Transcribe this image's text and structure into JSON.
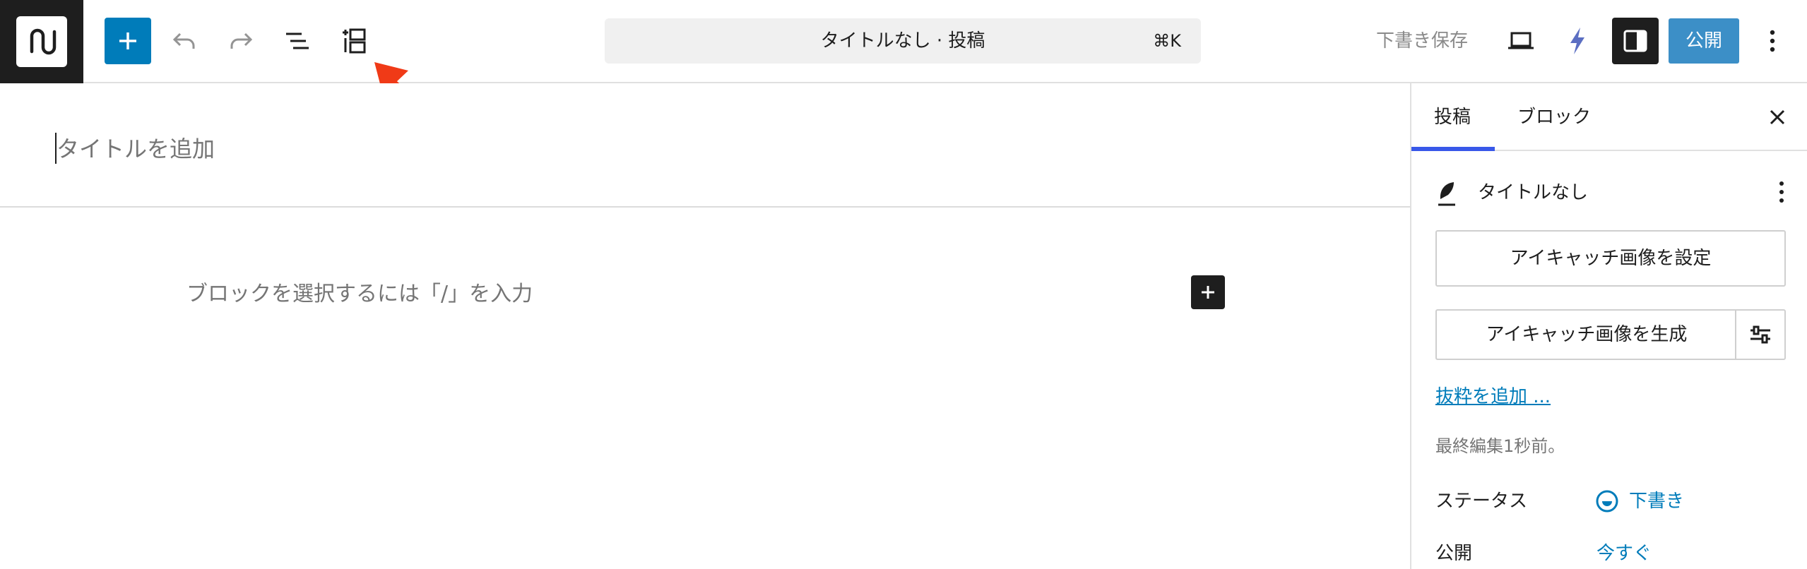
{
  "toolbar": {
    "command_title": "タイトルなし · 投稿",
    "command_shortcut": "⌘K",
    "save_draft_label": "下書き保存",
    "publish_label": "公開"
  },
  "icons": {
    "logo": "site-logo-icon",
    "add": "plus-icon",
    "undo": "undo-icon",
    "redo": "redo-icon",
    "list_view": "list-view-icon",
    "block_inserter": "block-inserter-icon",
    "preview": "laptop-icon",
    "bolt": "bolt-icon",
    "settings": "sidebar-icon",
    "options": "vertical-ellipsis-icon"
  },
  "editor": {
    "title_placeholder": "タイトルを追加",
    "block_placeholder": "ブロックを選択するには「/」を入力"
  },
  "sidebar": {
    "tabs": [
      {
        "label": "投稿"
      },
      {
        "label": "ブロック"
      }
    ],
    "post_title": "タイトルなし",
    "featured_image_set": "アイキャッチ画像を設定",
    "featured_image_generate": "アイキャッチ画像を生成",
    "excerpt_link": "抜粋を追加 ...",
    "last_edited": "最終編集1秒前。",
    "status_label": "ステータス",
    "status_value": "下書き",
    "publish_label": "公開",
    "publish_value": "今すぐ"
  },
  "colors": {
    "accent": "#007cba",
    "dark": "#1e1e1e",
    "tab_indicator": "#3858e9",
    "annotation_arrow": "#f03a17"
  }
}
